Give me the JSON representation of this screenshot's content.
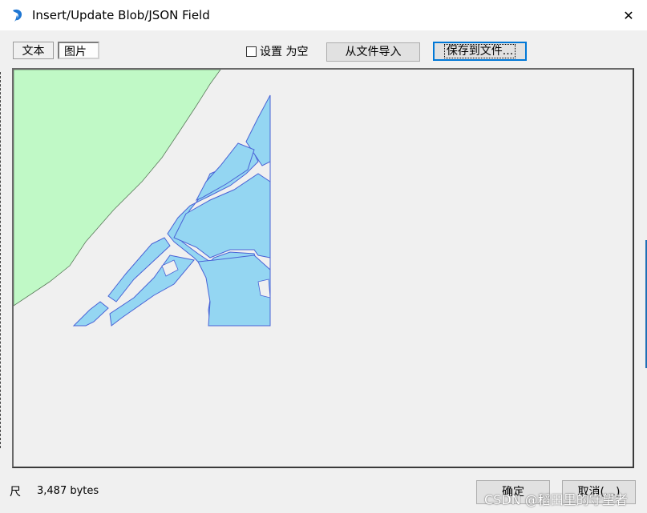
{
  "window": {
    "title": "Insert/Update Blob/JSON Field",
    "close_glyph": "✕"
  },
  "toolbar": {
    "tab_text": "文本",
    "tab_image": "图片",
    "set_null_label": "设置 为空",
    "set_null_checked": false,
    "import_label": "从文件导入",
    "save_label": "保存到文件..."
  },
  "footer": {
    "size_label": "尺",
    "size_value": "3,487 bytes",
    "ok_label": "确定",
    "cancel_label": "取消(…)"
  },
  "watermark": "CSDN @稻田里的守望者",
  "colors": {
    "land_green": "#c0f9c6",
    "water_blue": "#94d6f2",
    "water_stroke": "#4a63d6",
    "accent": "#0078d7"
  }
}
